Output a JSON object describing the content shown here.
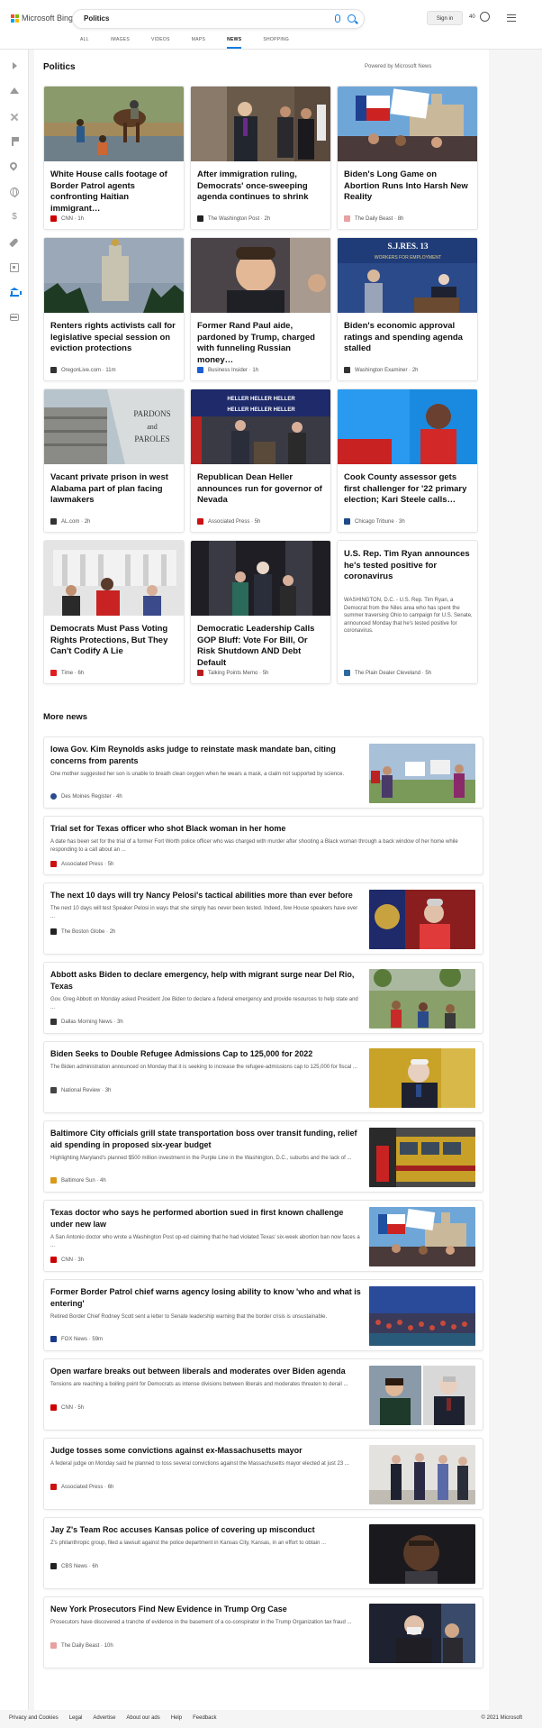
{
  "header": {
    "brand": "Microsoft Bing",
    "search_value": "Politics",
    "signin_label": "Sign in",
    "rewards_count": "40",
    "tabs": [
      "ALL",
      "IMAGES",
      "VIDEOS",
      "MAPS",
      "NEWS",
      "SHOPPING"
    ],
    "active_tab": "NEWS"
  },
  "sidebar": {
    "items": [
      "expand-icon",
      "home-icon",
      "coronavirus-icon",
      "flag-icon",
      "location-pin-icon",
      "globe-icon",
      "money-icon",
      "rocket-icon",
      "film-icon",
      "bank-icon",
      "credit-card-icon"
    ]
  },
  "section": {
    "title": "Politics",
    "powered_by": "Powered by Microsoft News"
  },
  "cards": [
    {
      "title": "White House calls footage of Border Patrol agents confronting Haitian immigrant…",
      "source": "CNN",
      "time": "1h",
      "logo_color": "#cc0000"
    },
    {
      "title": "After immigration ruling, Democrats' once-sweeping agenda continues to shrink",
      "source": "The Washington Post",
      "time": "2h",
      "logo_color": "#222222"
    },
    {
      "title": "Biden's Long Game on Abortion Runs Into Harsh New Reality",
      "source": "The Daily Beast",
      "time": "8h",
      "logo_color": "#e8a0a0"
    },
    {
      "title": "Renters rights activists call for legislative special session on eviction protections",
      "source": "OregonLive.com",
      "time": "11m",
      "logo_color": "#333333"
    },
    {
      "title": "Former Rand Paul aide, pardoned by Trump, charged with funneling Russian money…",
      "source": "Business Insider",
      "time": "1h",
      "logo_color": "#1a5fd6"
    },
    {
      "title": "Biden's economic approval ratings and spending agenda stalled",
      "source": "Washington Examiner",
      "time": "2h",
      "logo_color": "#333333"
    },
    {
      "title": "Vacant private prison in west Alabama part of plan facing lawmakers",
      "source": "AL.com",
      "time": "2h",
      "logo_color": "#333333"
    },
    {
      "title": "Republican Dean Heller announces run for governor of Nevada",
      "source": "Associated Press",
      "time": "5h",
      "logo_color": "#cc1111"
    },
    {
      "title": "Cook County assessor gets first challenger for '22 primary election; Kari Steele calls…",
      "source": "Chicago Tribune",
      "time": "3h",
      "logo_color": "#1f4a8a"
    },
    {
      "title": "Democrats Must Pass Voting Rights Protections, But They Can't Codify A Lie",
      "source": "Time",
      "time": "6h",
      "logo_color": "#e01e1e"
    },
    {
      "title": "Democratic Leadership Calls GOP Bluff: Vote For Bill, Or Risk Shutdown AND Debt Default",
      "source": "Talking Points Memo",
      "time": "5h",
      "logo_color": "#b81c1c"
    },
    {
      "title": "U.S. Rep. Tim Ryan announces he's tested positive for coronavirus",
      "body": "WASHINGTON, D.C. - U.S. Rep. Tim Ryan, a Democrat from the Niles area who has spent the summer traversing Ohio to campaign for U.S. Senate, announced Monday that he's tested positive for coronavirus.",
      "source": "The Plain Dealer Cleveland",
      "time": "5h",
      "logo_color": "#2c6aa0"
    }
  ],
  "more_news": {
    "title": "More news",
    "items": [
      {
        "title": "Iowa Gov. Kim Reynolds asks judge to reinstate mask mandate ban, citing concerns from parents",
        "body": "One mother suggested her son is unable to breath clean oxygen when he wears a mask, a claim not supported by science.",
        "source": "Des Moines Register",
        "time": "4h",
        "logo_color": "#2b4c8c"
      },
      {
        "title": "Trial set for Texas officer who shot Black woman in her home",
        "body": "A date has been set for the trial of a former Fort Worth police officer who was charged with murder after shooting a Black woman through a back window of her home while responding to a call about an ...",
        "source": "Associated Press",
        "time": "5h",
        "logo_color": "#cc1111"
      },
      {
        "title": "The next 10 days will try Nancy Pelosi's tactical abilities more than ever before",
        "body": "The next 10 days will test Speaker Pelosi in ways that she simply has never been tested. Indeed, few House speakers have ever ...",
        "source": "The Boston Globe",
        "time": "2h",
        "logo_color": "#222222"
      },
      {
        "title": "Abbott asks Biden to declare emergency, help with migrant surge near Del Rio, Texas",
        "body": "Gov. Greg Abbott on Monday asked President Joe Biden to declare a federal emergency and provide resources to help state and ...",
        "source": "Dallas Morning News",
        "time": "3h",
        "logo_color": "#333333"
      },
      {
        "title": "Biden Seeks to Double Refugee Admissions Cap to 125,000 for 2022",
        "body": "The Biden administration announced on Monday that it is seeking to increase the refugee-admissions cap to 125,000 for fiscal ...",
        "source": "National Review",
        "time": "3h",
        "logo_color": "#444444"
      },
      {
        "title": "Baltimore City officials grill state transportation boss over transit funding, relief aid spending in proposed six-year budget",
        "body": "Highlighting Maryland's planned $500 million investment in the Purple Line in the Washington, D.C., suburbs and the lack of ...",
        "source": "Baltimore Sun",
        "time": "4h",
        "logo_color": "#d89a1a"
      },
      {
        "title": "Texas doctor who says he performed abortion sued in first known challenge under new law",
        "body": "A San Antonio doctor who wrote a Washington Post op-ed claiming that he had violated Texas' six-week abortion ban now faces a ...",
        "source": "CNN",
        "time": "3h",
        "logo_color": "#cc0000"
      },
      {
        "title": "Former Border Patrol chief warns agency losing ability to know 'who and what is entering'",
        "body": "Retired Border Chief Rodney Scott sent a letter to Senate leadership warning that the border crisis is unsustainable.",
        "source": "FOX News",
        "time": "59m",
        "logo_color": "#1a3a8a"
      },
      {
        "title": "Open warfare breaks out between liberals and moderates over Biden agenda",
        "body": "Tensions are reaching a boiling point for Democrats as intense divisions between liberals and moderates threaten to derail ...",
        "source": "CNN",
        "time": "5h",
        "logo_color": "#cc0000"
      },
      {
        "title": "Judge tosses some convictions against ex-Massachusetts mayor",
        "body": "A federal judge on Monday said he planned to toss several convictions against the Massachusetts mayor elected at just 23 ...",
        "source": "Associated Press",
        "time": "6h",
        "logo_color": "#cc1111"
      },
      {
        "title": "Jay Z's Team Roc accuses Kansas police of covering up misconduct",
        "body": "Z's philanthropic group, filed a lawsuit against the police department in Kansas City, Kansas, in an effort to obtain ...",
        "source": "CBS News",
        "time": "6h",
        "logo_color": "#222222"
      },
      {
        "title": "New York Prosecutors Find New Evidence in Trump Org Case",
        "body": "Prosecutors have discovered a tranche of evidence in the basement of a co-conspirator in the Trump Organization tax fraud ...",
        "source": "The Daily Beast",
        "time": "10h",
        "logo_color": "#e8a0a0"
      }
    ]
  },
  "footer": {
    "links": [
      "Privacy and Cookies",
      "Legal",
      "Advertise",
      "About our ads",
      "Help",
      "Feedback"
    ],
    "copyright": "© 2021 Microsoft"
  },
  "colors": {
    "accent": "#0b7de0"
  }
}
